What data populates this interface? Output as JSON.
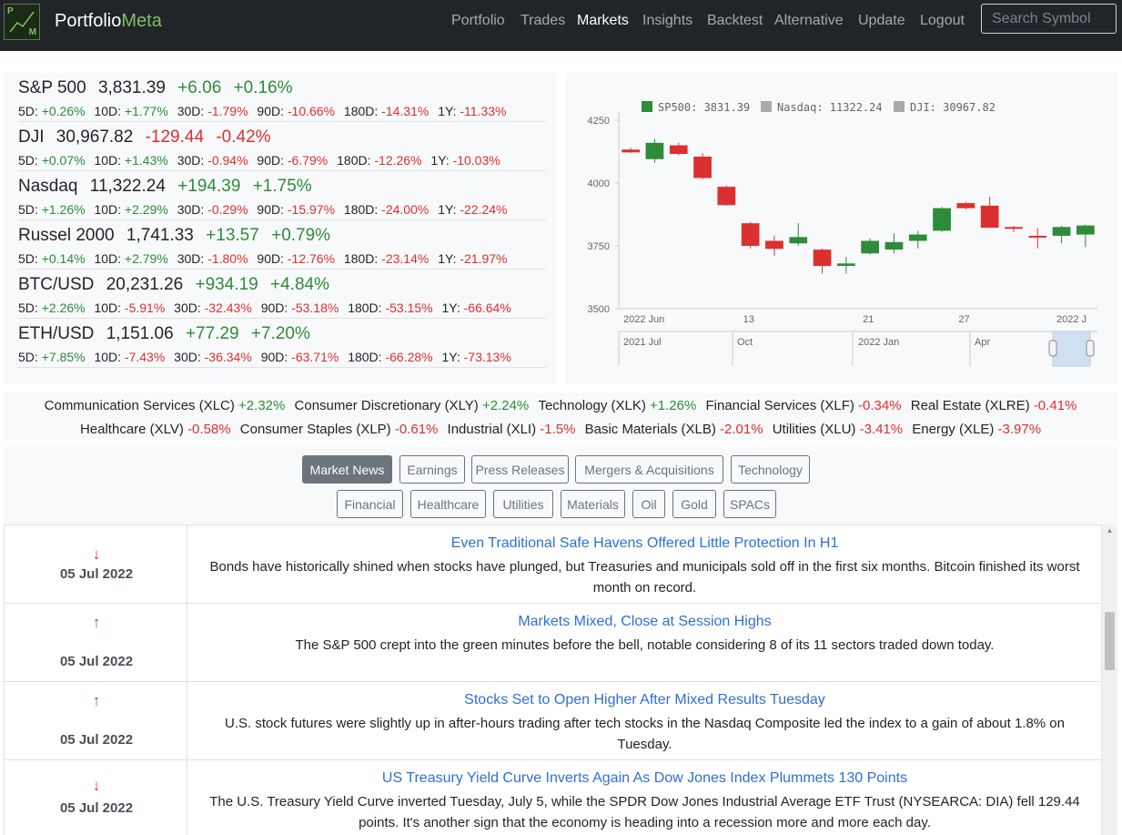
{
  "brand": {
    "name_a": "Portfolio",
    "name_b": "Meta",
    "logo_p": "P",
    "logo_m": "M"
  },
  "nav": [
    "Portfolio",
    "Trades",
    "Markets",
    "Insights",
    "Backtest",
    "Alternative",
    "Update",
    "Logout"
  ],
  "nav_active": "Markets",
  "search": {
    "placeholder": "Search Symbol"
  },
  "indices": [
    {
      "name": "S&P 500",
      "price": "3,831.39",
      "change": "+6.06",
      "pct": "+0.16%",
      "dir": "pos",
      "perf": [
        [
          "5D:",
          "+0.26%",
          "pos"
        ],
        [
          "10D:",
          "+1.77%",
          "pos"
        ],
        [
          "30D:",
          "-1.79%",
          "neg"
        ],
        [
          "90D:",
          "-10.66%",
          "neg"
        ],
        [
          "180D:",
          "-14.31%",
          "neg"
        ],
        [
          "1Y:",
          "-11.33%",
          "neg"
        ]
      ]
    },
    {
      "name": "DJI",
      "price": "30,967.82",
      "change": "-129.44",
      "pct": "-0.42%",
      "dir": "neg",
      "perf": [
        [
          "5D:",
          "+0.07%",
          "pos"
        ],
        [
          "10D:",
          "+1.43%",
          "pos"
        ],
        [
          "30D:",
          "-0.94%",
          "neg"
        ],
        [
          "90D:",
          "-6.79%",
          "neg"
        ],
        [
          "180D:",
          "-12.26%",
          "neg"
        ],
        [
          "1Y:",
          "-10.03%",
          "neg"
        ]
      ]
    },
    {
      "name": "Nasdaq",
      "price": "11,322.24",
      "change": "+194.39",
      "pct": "+1.75%",
      "dir": "pos",
      "perf": [
        [
          "5D:",
          "+1.26%",
          "pos"
        ],
        [
          "10D:",
          "+2.29%",
          "pos"
        ],
        [
          "30D:",
          "-0.29%",
          "neg"
        ],
        [
          "90D:",
          "-15.97%",
          "neg"
        ],
        [
          "180D:",
          "-24.00%",
          "neg"
        ],
        [
          "1Y:",
          "-22.24%",
          "neg"
        ]
      ]
    },
    {
      "name": "Russel 2000",
      "price": "1,741.33",
      "change": "+13.57",
      "pct": "+0.79%",
      "dir": "pos",
      "perf": [
        [
          "5D:",
          "+0.14%",
          "pos"
        ],
        [
          "10D:",
          "+2.79%",
          "pos"
        ],
        [
          "30D:",
          "-1.80%",
          "neg"
        ],
        [
          "90D:",
          "-12.76%",
          "neg"
        ],
        [
          "180D:",
          "-23.14%",
          "neg"
        ],
        [
          "1Y:",
          "-21.97%",
          "neg"
        ]
      ]
    },
    {
      "name": "BTC/USD",
      "price": "20,231.26",
      "change": "+934.19",
      "pct": "+4.84%",
      "dir": "pos",
      "perf": [
        [
          "5D:",
          "+2.26%",
          "pos"
        ],
        [
          "10D:",
          "-5.91%",
          "neg"
        ],
        [
          "30D:",
          "-32.43%",
          "neg"
        ],
        [
          "90D:",
          "-53.18%",
          "neg"
        ],
        [
          "180D:",
          "-53.15%",
          "neg"
        ],
        [
          "1Y:",
          "-66.64%",
          "neg"
        ]
      ]
    },
    {
      "name": "ETH/USD",
      "price": "1,151.06",
      "change": "+77.29",
      "pct": "+7.20%",
      "dir": "pos",
      "perf": [
        [
          "5D:",
          "+7.85%",
          "pos"
        ],
        [
          "10D:",
          "-7.43%",
          "neg"
        ],
        [
          "30D:",
          "-36.34%",
          "neg"
        ],
        [
          "90D:",
          "-63.71%",
          "neg"
        ],
        [
          "180D:",
          "-66.28%",
          "neg"
        ],
        [
          "1Y:",
          "-73.13%",
          "neg"
        ]
      ]
    }
  ],
  "chart_data": {
    "type": "candlestick",
    "legend": [
      {
        "label": "SP500: 3831.39",
        "color": "#2e8b3a"
      },
      {
        "label": "Nasdaq: 11322.24",
        "color": "#aaaaaa"
      },
      {
        "label": "DJI: 30967.82",
        "color": "#aaaaaa"
      }
    ],
    "y_ticks": [
      3500,
      3750,
      4000,
      4250
    ],
    "ylim": [
      3500,
      4250
    ],
    "x_tick_labels": [
      "2022 Jun",
      "13",
      "21",
      "27",
      "2022 J"
    ],
    "x_tick_index": [
      0,
      5,
      10,
      14,
      19
    ],
    "navigator_labels": [
      "2021 Jul",
      "Oct",
      "2022 Jan",
      "Apr"
    ],
    "up_color": "#2e8b3a",
    "down_color": "#dc3030",
    "candles": [
      {
        "o": 4133,
        "h": 4140,
        "l": 4120,
        "c": 4122
      },
      {
        "o": 4095,
        "h": 4175,
        "l": 4080,
        "c": 4160
      },
      {
        "o": 4150,
        "h": 4160,
        "l": 4110,
        "c": 4116
      },
      {
        "o": 4105,
        "h": 4120,
        "l": 4015,
        "c": 4020
      },
      {
        "o": 3985,
        "h": 3990,
        "l": 3910,
        "c": 3912
      },
      {
        "o": 3840,
        "h": 3845,
        "l": 3740,
        "c": 3750
      },
      {
        "o": 3770,
        "h": 3790,
        "l": 3710,
        "c": 3738
      },
      {
        "o": 3760,
        "h": 3840,
        "l": 3750,
        "c": 3785
      },
      {
        "o": 3735,
        "h": 3740,
        "l": 3640,
        "c": 3670
      },
      {
        "o": 3670,
        "h": 3705,
        "l": 3640,
        "c": 3680
      },
      {
        "o": 3720,
        "h": 3780,
        "l": 3715,
        "c": 3770
      },
      {
        "o": 3735,
        "h": 3800,
        "l": 3720,
        "c": 3765
      },
      {
        "o": 3770,
        "h": 3810,
        "l": 3740,
        "c": 3795
      },
      {
        "o": 3810,
        "h": 3905,
        "l": 3805,
        "c": 3900
      },
      {
        "o": 3920,
        "h": 3925,
        "l": 3895,
        "c": 3900
      },
      {
        "o": 3910,
        "h": 3945,
        "l": 3825,
        "c": 3822
      },
      {
        "o": 3825,
        "h": 3830,
        "l": 3805,
        "c": 3818
      },
      {
        "o": 3790,
        "h": 3820,
        "l": 3740,
        "c": 3788
      },
      {
        "o": 3790,
        "h": 3830,
        "l": 3760,
        "c": 3825
      },
      {
        "o": 3795,
        "h": 3835,
        "l": 3745,
        "c": 3831
      }
    ]
  },
  "sectors_line1": [
    [
      "Communication Services (XLC)",
      "+2.32%",
      "pos"
    ],
    [
      "Consumer Discretionary (XLY)",
      "+2.24%",
      "pos"
    ],
    [
      "Technology (XLK)",
      "+1.26%",
      "pos"
    ],
    [
      "Financial Services (XLF)",
      "-0.34%",
      "neg"
    ],
    [
      "Real Estate (XLRE)",
      "-0.41%",
      "neg"
    ]
  ],
  "sectors_line2": [
    [
      "Healthcare (XLV)",
      "-0.58%",
      "neg"
    ],
    [
      "Consumer Staples (XLP)",
      "-0.61%",
      "neg"
    ],
    [
      "Industrial (XLI)",
      "-1.5%",
      "neg"
    ],
    [
      "Basic Materials (XLB)",
      "-2.01%",
      "neg"
    ],
    [
      "Utilities (XLU)",
      "-3.41%",
      "neg"
    ],
    [
      "Energy (XLE)",
      "-3.97%",
      "neg"
    ]
  ],
  "categories_row1": [
    "Market News",
    "Earnings",
    "Press Releases",
    "Mergers & Acquisitions",
    "Technology"
  ],
  "categories_row2": [
    "Financial",
    "Healthcare",
    "Utilities",
    "Materials",
    "Oil",
    "Gold",
    "SPACs"
  ],
  "category_active": "Market News",
  "news": [
    {
      "dir": "down",
      "arrow": "↓",
      "date": "05 Jul 2022",
      "title": "Even Traditional Safe Havens Offered Little Protection In H1",
      "summary": "Bonds have historically shined when stocks have plunged, but Treasuries and municipals sold off in the first six months. Bitcoin finished its worst month on record."
    },
    {
      "dir": "up",
      "arrow": "↑",
      "date": "05 Jul 2022",
      "title": "Markets Mixed, Close at Session Highs",
      "summary": "The S&P 500 crept into the green minutes before the bell, notable considering 8 of its 11 sectors traded down today."
    },
    {
      "dir": "up",
      "arrow": "↑",
      "date": "05 Jul 2022",
      "title": "Stocks Set to Open Higher After Mixed Results Tuesday",
      "summary": "U.S. stock futures were slightly up in after-hours trading after tech stocks in the Nasdaq Composite led the index to a gain of about 1.8% on Tuesday."
    },
    {
      "dir": "down",
      "arrow": "↓",
      "date": "05 Jul 2022",
      "title": "US Treasury Yield Curve Inverts Again As Dow Jones Index Plummets 130 Points",
      "summary": "The U.S. Treasury Yield Curve inverted Tuesday, July 5, while the SPDR Dow Jones Industrial Average ETF Trust (NYSEARCA: DIA) fell 129.44 points. It's another sign that the economy is heading into a recession more and more each day."
    }
  ]
}
